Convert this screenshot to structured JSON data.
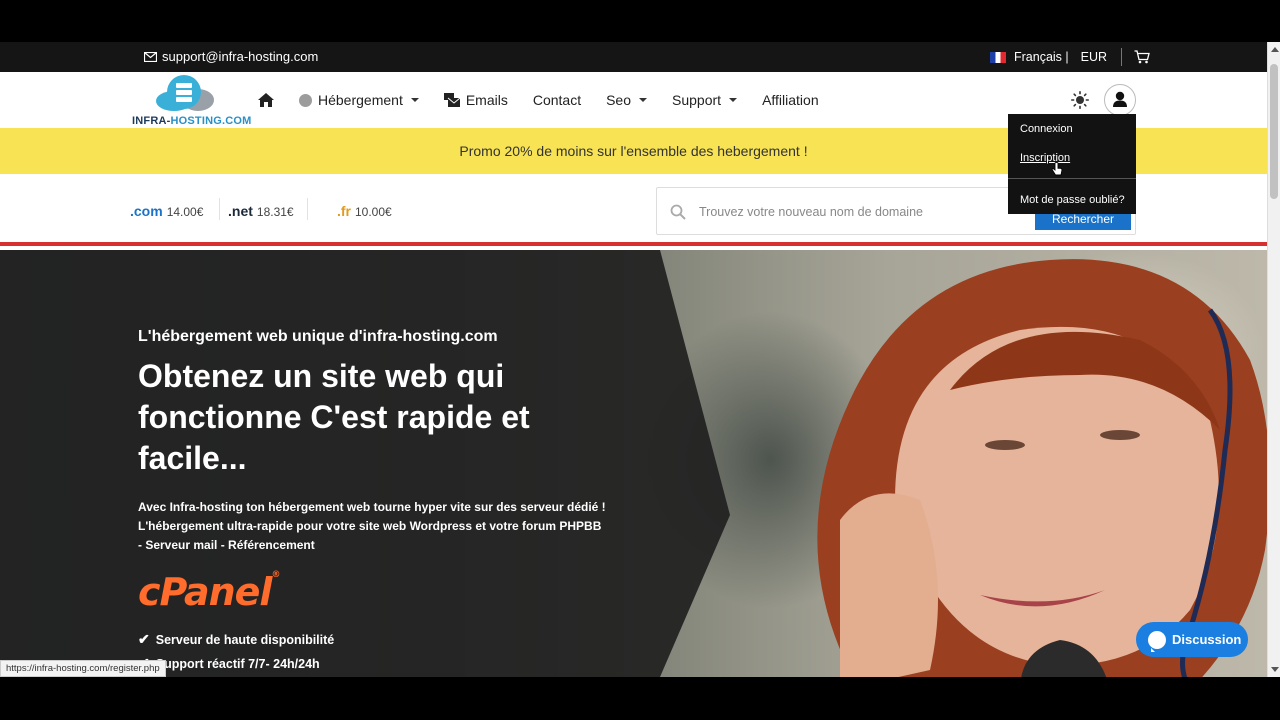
{
  "topbar": {
    "email": "support@infra-hosting.com",
    "language": "Français",
    "language_sep": "|",
    "currency": "EUR"
  },
  "logo": {
    "brand_part1": "INFRA-",
    "brand_part2": "HOSTING.COM"
  },
  "nav": {
    "items": [
      {
        "label": "Hébergement",
        "has_dropdown": true
      },
      {
        "label": "Emails"
      },
      {
        "label": "Contact"
      },
      {
        "label": "Seo",
        "has_dropdown": true
      },
      {
        "label": "Support",
        "has_dropdown": true
      },
      {
        "label": "Affiliation"
      }
    ]
  },
  "account_menu": {
    "login": "Connexion",
    "register": "Inscription",
    "forgot": "Mot de passe oublié?"
  },
  "promo": {
    "text": "Promo 20% de moins sur l'ensemble des hebergement !"
  },
  "domains": {
    "tlds": [
      {
        "ext": ".com",
        "price": "14.00€",
        "color": "#1a73c8"
      },
      {
        "ext": ".net",
        "price": "18.31€",
        "color": "#1b2a3a"
      },
      {
        "ext": ".fr",
        "price": "10.00€",
        "color": "#e39b1d"
      }
    ],
    "search_placeholder": "Trouvez votre nouveau nom de domaine",
    "search_button": "Rechercher"
  },
  "hero": {
    "subtitle": "L'hébergement web unique d'infra-hosting.com",
    "title": "Obtenez un site web qui fonctionne C'est rapide et facile...",
    "desc_line1": "Avec Infra-hosting ton hébergement web tourne hyper vite sur des serveur dédié !",
    "desc_line2": "L'hébergement ultra-rapide pour votre site web Wordpress et votre forum PHPBB",
    "desc_line3": "- Serveur mail - Référencement",
    "cpanel": "cPanel",
    "features": [
      "Serveur de haute disponibilité",
      "Support réactif 7/7- 24h/24h"
    ]
  },
  "status_url": "https://infra-hosting.com/register.php",
  "chat": {
    "label": "Discussion"
  },
  "colors": {
    "promo": "#f7e353",
    "accent_red": "#d73030",
    "chat_blue": "#1a7fe0",
    "cpanel_orange": "#ff6c2c"
  }
}
